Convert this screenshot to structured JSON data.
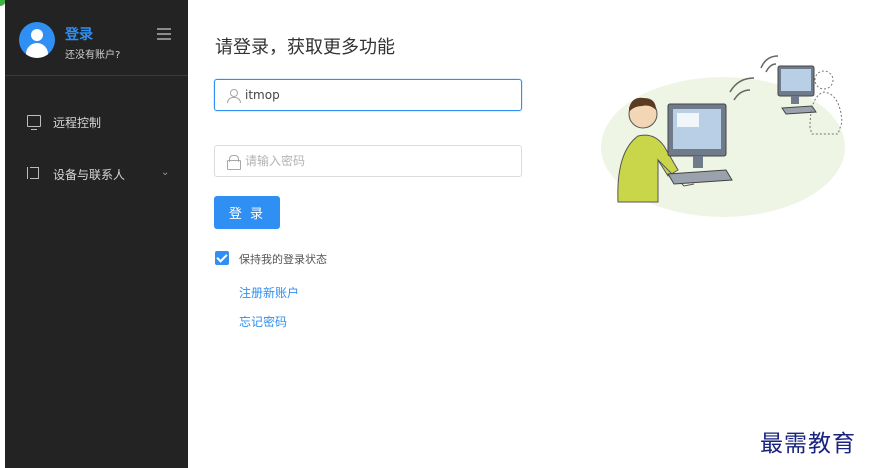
{
  "sidebar": {
    "login_label": "登录",
    "no_account_label": "还没有账户?",
    "items": [
      {
        "label": "远程控制",
        "icon": "monitor-icon"
      },
      {
        "label": "设备与联系人",
        "icon": "contacts-icon",
        "has_dropdown": true
      }
    ]
  },
  "main": {
    "title": "请登录，获取更多功能",
    "username": {
      "value": "itmop",
      "icon": "user-icon"
    },
    "password": {
      "value": "",
      "placeholder": "请输入密码",
      "icon": "lock-icon"
    },
    "login_button": "登 录",
    "remember_me": {
      "label": "保持我的登录状态",
      "checked": true
    },
    "register_link": "注册新账户",
    "forgot_link": "忘记密码"
  },
  "watermark": "最需教育",
  "colors": {
    "accent": "#2f8ff2",
    "sidebar_bg": "#232323",
    "watermark": "#1a237e"
  }
}
